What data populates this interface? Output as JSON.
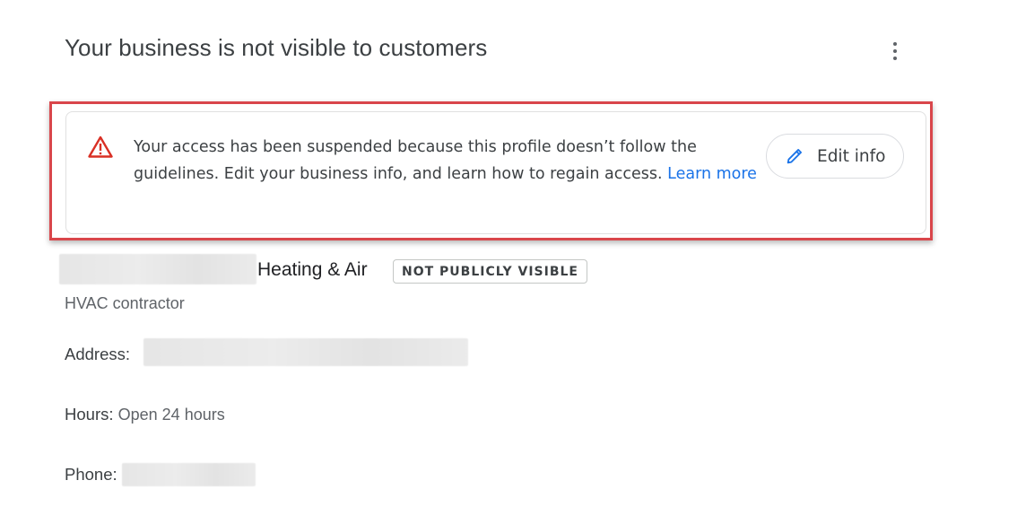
{
  "header": {
    "title": "Your business is not visible to customers",
    "more_icon": "more-vert-icon"
  },
  "alert": {
    "icon": "warning-icon",
    "message": "Your access has been suspended because this profile doesn’t follow the guidelines. Edit your business info, and learn how to regain access.",
    "learn_more_label": "Learn more",
    "edit_button_label": "Edit info",
    "edit_button_icon": "pencil-icon",
    "warning_color": "#d93025",
    "highlight_color": "#d9464b",
    "link_color": "#1a73e8"
  },
  "business": {
    "name_suffix": "Heating & Air",
    "status_badge": "NOT PUBLICLY VISIBLE",
    "category": "HVAC contractor",
    "address_label": "Address:",
    "hours_label": "Hours:",
    "hours_value": "Open 24 hours",
    "phone_label": "Phone:"
  }
}
